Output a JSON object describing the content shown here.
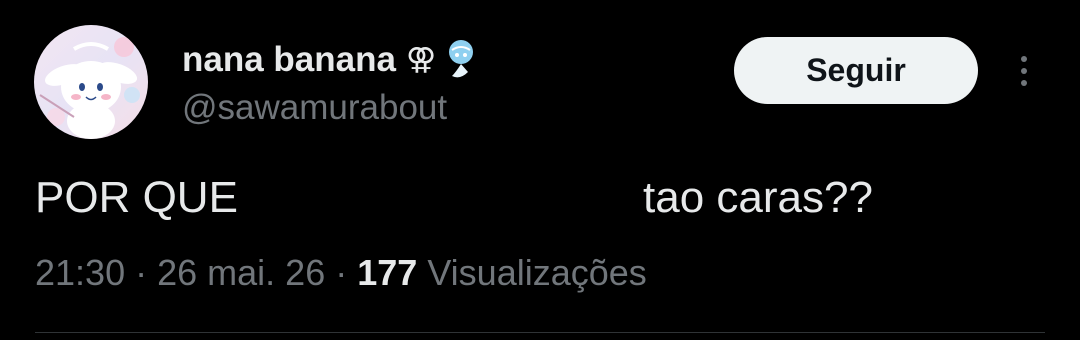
{
  "tweet": {
    "author": {
      "display_name": "nana banana",
      "name_symbol": "⚢",
      "handle": "@sawamurabout",
      "avatar_icon": "cinnamoroll-avatar"
    },
    "follow_label": "Seguir",
    "text_part_1": "POR QUE",
    "text_part_2": "tao caras??",
    "meta": {
      "time": "21:30",
      "separator": "·",
      "date": "26 mai. 26",
      "views_count": "177",
      "views_label": "Visualizações"
    }
  },
  "colors": {
    "background": "#000000",
    "primary_text": "#e7e9ea",
    "secondary_text": "#71767b",
    "button_bg": "#eff3f4",
    "button_text": "#0f1419",
    "divider": "#2f3336"
  }
}
